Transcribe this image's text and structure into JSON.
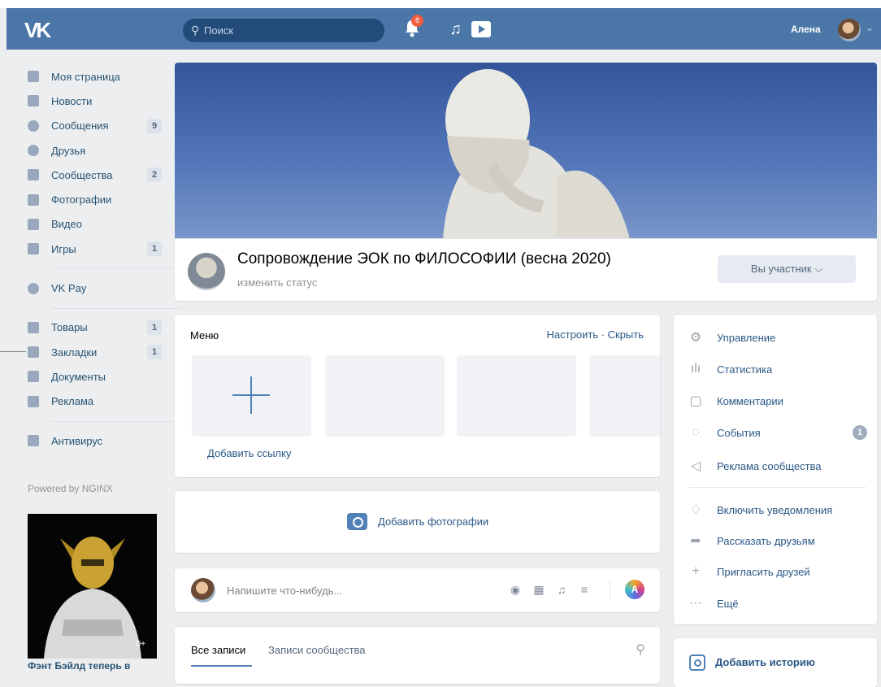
{
  "header": {
    "logo": "VK",
    "search_placeholder": "Поиск",
    "notifications_count": "8",
    "user_name": "Алена"
  },
  "leftnav": {
    "items": [
      {
        "label": "Моя страница",
        "icon": "home-icon"
      },
      {
        "label": "Новости",
        "icon": "news-icon"
      },
      {
        "label": "Сообщения",
        "icon": "messages-icon",
        "count": "9"
      },
      {
        "label": "Друзья",
        "icon": "friends-icon"
      },
      {
        "label": "Сообщества",
        "icon": "communities-icon",
        "count": "2"
      },
      {
        "label": "Фотографии",
        "icon": "photos-icon"
      },
      {
        "label": "Видео",
        "icon": "video-icon"
      },
      {
        "label": "Игры",
        "icon": "games-icon",
        "count": "1"
      }
    ],
    "vkpay": "VK Pay",
    "items2": [
      {
        "label": "Товары",
        "icon": "market-icon",
        "count": "1"
      },
      {
        "label": "Закладки",
        "icon": "bookmarks-icon",
        "count": "1"
      },
      {
        "label": "Документы",
        "icon": "documents-icon"
      },
      {
        "label": "Реклама",
        "icon": "ads-icon"
      }
    ],
    "antivirus": "Антивирус",
    "powered": "Powered by NGINX",
    "promo_age": "0+",
    "promo_caption": "Фэнт Бэйлд теперь в"
  },
  "group": {
    "title": "Сопровождение ЭОК по ФИЛОСОФИИ (весна 2020)",
    "status": "изменить статус",
    "member_button": "Вы участник ⌵"
  },
  "menu": {
    "heading": "Меню",
    "actions": "Настроить · Скрыть",
    "add_link": "Добавить ссылку"
  },
  "photos": {
    "add_label": "Добавить фотографии"
  },
  "post": {
    "placeholder": "Напишите что-нибудь..."
  },
  "wall": {
    "tab_all": "Все записи",
    "tab_community": "Записи сообщества"
  },
  "sidebar": {
    "items": [
      {
        "label": "Управление",
        "icon": "gear-icon",
        "glyph": "⚙"
      },
      {
        "label": "Статистика",
        "icon": "stats-icon",
        "glyph": "ılı"
      },
      {
        "label": "Комментарии",
        "icon": "comment-icon",
        "glyph": "▢"
      },
      {
        "label": "События",
        "icon": "events-icon",
        "glyph": "◌",
        "count": "1"
      },
      {
        "label": "Реклама сообщества",
        "icon": "megaphone-icon",
        "glyph": "◁"
      },
      {
        "label": "Включить уведомления",
        "icon": "bell-icon",
        "glyph": "♫"
      },
      {
        "label": "Рассказать друзьям",
        "icon": "share-icon",
        "glyph": "➦"
      },
      {
        "label": "Пригласить друзей",
        "icon": "invite-icon",
        "glyph": "+"
      },
      {
        "label": "Ещё",
        "icon": "more-icon",
        "glyph": "···"
      }
    ],
    "story": "Добавить историю"
  },
  "colors": {
    "header": "#4a76a8",
    "link": "#2a5885",
    "background": "#edeef0"
  }
}
